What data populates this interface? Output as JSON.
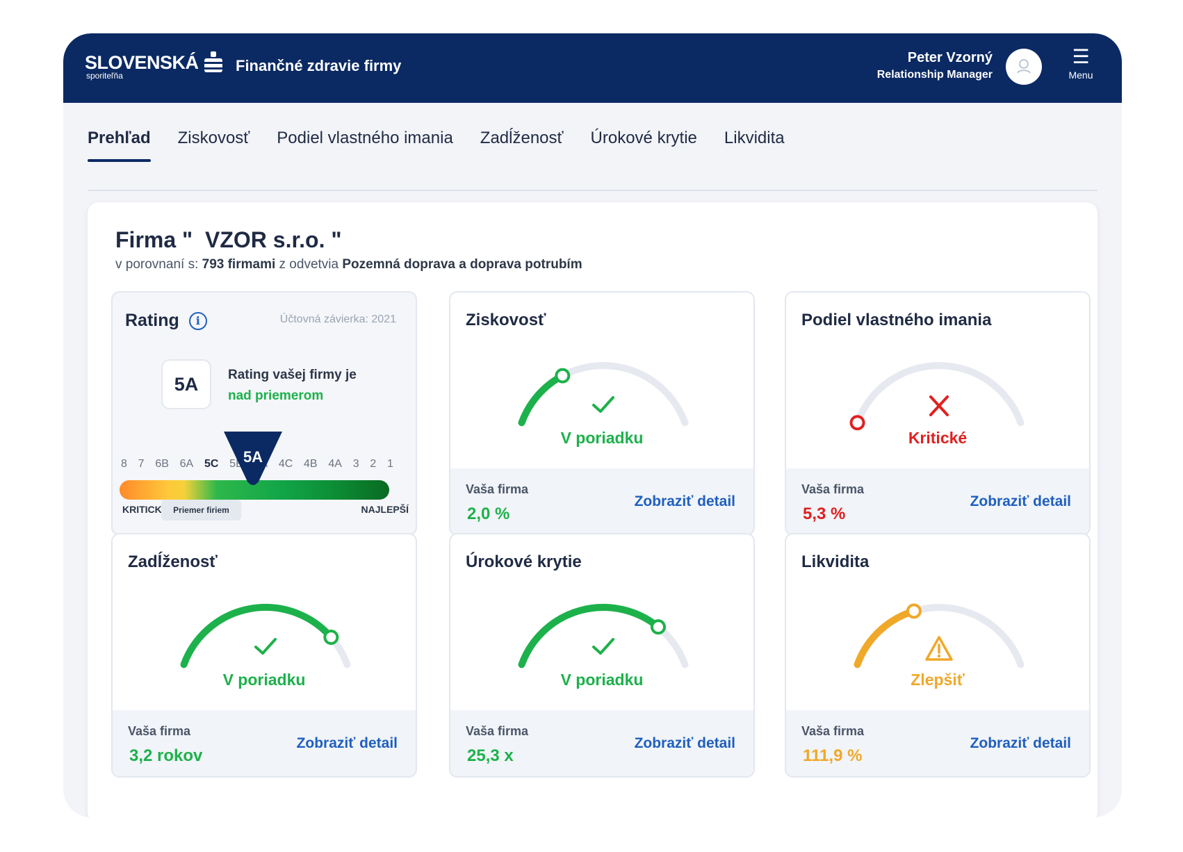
{
  "header": {
    "brand": "SLOVENSKÁ",
    "brand_sub": "sporiteľňa",
    "app_title": "Finančné zdravie firmy",
    "user_name": "Peter Vzorný",
    "user_role": "Relationship Manager",
    "menu_label": "Menu"
  },
  "tabs": [
    {
      "label": "Prehľad",
      "active": true
    },
    {
      "label": "Ziskovosť"
    },
    {
      "label": "Podiel vlastného imania"
    },
    {
      "label": "Zadĺženosť"
    },
    {
      "label": "Úrokové krytie"
    },
    {
      "label": "Likvidita"
    }
  ],
  "firm": {
    "title": "Firma \"  VZOR s.r.o. \"",
    "sub_prefix": "v porovnaní s: ",
    "count": "793 firmami",
    "sub_mid": " z odvetvia ",
    "industry": "Pozemná doprava a doprava potrubím"
  },
  "rating": {
    "title": "Rating",
    "year": "Účtovná závierka: 2021",
    "value": "5A",
    "text_line1": "Rating vašej firmy je",
    "text_line2": "nad priemerom",
    "scale": [
      "8",
      "7",
      "6B",
      "6A",
      "5C",
      "5B",
      "5A",
      "4C",
      "4B",
      "4A",
      "3",
      "2",
      "1"
    ],
    "marker": "5A",
    "left_label": "KRITICKÝ",
    "right_label": "NAJLEPŠÍ",
    "avg_label": "Priemer firiem"
  },
  "cards": [
    {
      "title": "Ziskovosť",
      "status": "V poriadku",
      "status_type": "ok",
      "foot_label": "Vaša firma",
      "value": "2,0 %",
      "link": "Zobraziť detail",
      "level": 0.3,
      "color": "#1db14b"
    },
    {
      "title": "Podiel vlastného imania",
      "status": "Kritické",
      "status_type": "critical",
      "foot_label": "Vaša firma",
      "value": "5,3 %",
      "link": "Zobraziť detail",
      "level": 0.0,
      "color": "#e02020"
    },
    {
      "title": "Zadĺženosť",
      "status": "V poriadku",
      "status_type": "ok",
      "foot_label": "Vaša firma",
      "value": "3,2 rokov",
      "link": "Zobraziť detail",
      "level": 0.85,
      "color": "#1db14b"
    },
    {
      "title": "Úrokové krytie",
      "status": "V poriadku",
      "status_type": "ok",
      "foot_label": "Vaša firma",
      "value": "25,3 x",
      "link": "Zobraziť detail",
      "level": 0.78,
      "color": "#1db14b"
    },
    {
      "title": "Likvidita",
      "status": "Zlepšiť",
      "status_type": "warn",
      "foot_label": "Vaša firma",
      "value": "111,9 %",
      "link": "Zobraziť detail",
      "level": 0.38,
      "color": "#f0a829"
    }
  ]
}
